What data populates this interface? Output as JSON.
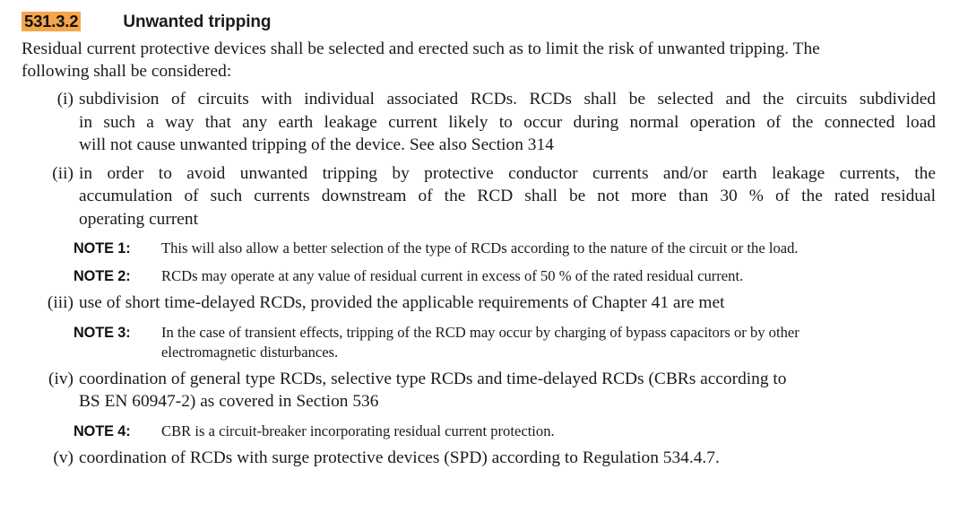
{
  "heading": {
    "clause_number": "531.3.2",
    "title": "Unwanted tripping",
    "highlight_color": "#F5A64B"
  },
  "intro": {
    "line1": "Residual current protective devices shall be selected and erected such as to limit the risk of unwanted tripping. The",
    "line2": "following shall be considered:"
  },
  "items": [
    {
      "marker": "(i)",
      "line1": "subdivision of circuits with individual associated RCDs. RCDs shall be selected and the circuits subdivided",
      "line2": "in such a way that any earth leakage current likely to occur during normal operation of the connected load",
      "line3": "will not cause unwanted tripping of the device. See also Section 314"
    },
    {
      "marker": "(ii)",
      "line1": "in order to avoid unwanted tripping by protective conductor currents and/or earth leakage currents, the",
      "line2": "accumulation of such currents downstream of the RCD shall be not more than 30 % of the rated residual",
      "line3": "operating current"
    },
    {
      "marker": "(iii)",
      "line1": "use of short time-delayed RCDs, provided the applicable requirements of Chapter 41 are met"
    },
    {
      "marker": "(iv)",
      "line1": "coordination of general type RCDs, selective type RCDs and time-delayed RCDs (CBRs according to",
      "line2": "BS EN 60947-2) as covered in Section 536"
    },
    {
      "marker": "(v)",
      "line1": "coordination of RCDs with surge protective devices (SPD) according to Regulation 534.4.7."
    }
  ],
  "notes": [
    {
      "label": "NOTE 1:",
      "line1": "This will also allow a better selection of the type of RCDs according to the nature of the circuit or the load."
    },
    {
      "label": "NOTE 2:",
      "line1": "RCDs may operate at any value of residual current in excess of 50 % of the rated residual current."
    },
    {
      "label": "NOTE 3:",
      "line1": "In the case of transient effects, tripping of the RCD may occur by charging of bypass capacitors or by other",
      "line2": "electromagnetic disturbances."
    },
    {
      "label": "NOTE 4:",
      "line1": "CBR is a circuit-breaker incorporating residual current protection."
    }
  ]
}
